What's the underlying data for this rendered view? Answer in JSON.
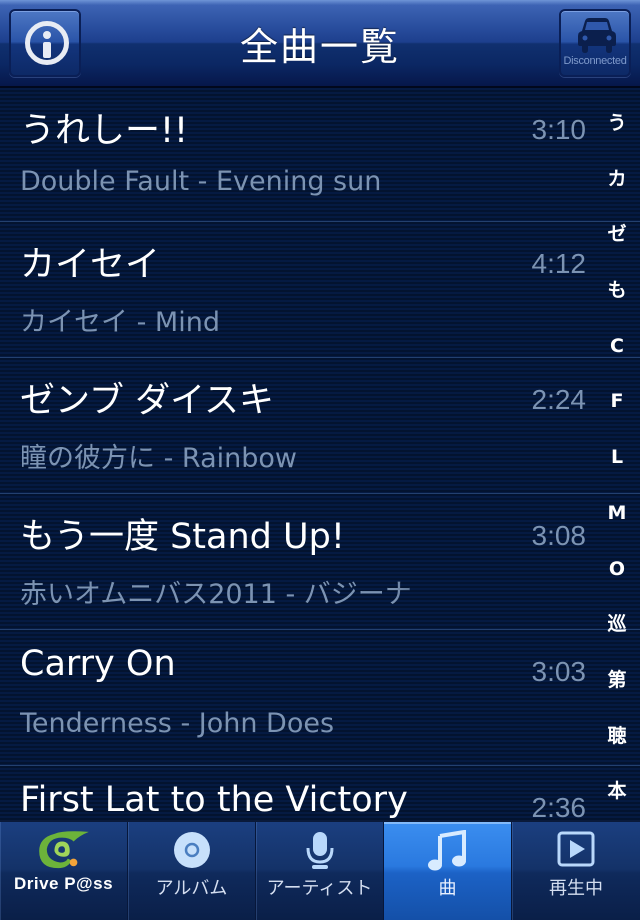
{
  "navbar": {
    "title": "全曲一覧",
    "info_button": {
      "icon": "info-icon"
    },
    "connection_button": {
      "icon": "car-icon",
      "status": "Disconnected"
    }
  },
  "songs": [
    {
      "title": "うれしー!!",
      "subtitle": "Double Fault - Evening sun",
      "duration": "3:10"
    },
    {
      "title": "カイセイ",
      "subtitle": "カイセイ - Mind",
      "duration": "4:12"
    },
    {
      "title": "ゼンブ ダイスキ",
      "subtitle": "瞳の彼方に - Rainbow",
      "duration": "2:24"
    },
    {
      "title": "もう一度 Stand Up!",
      "subtitle": "赤いオムニバス2011 - バジーナ",
      "duration": "3:08"
    },
    {
      "title": "Carry On",
      "subtitle": "Tenderness - John Does",
      "duration": "3:03"
    },
    {
      "title": "First Lat to the Victory",
      "subtitle": "",
      "duration": "2:36"
    }
  ],
  "index_bar": [
    "う",
    "カ",
    "ゼ",
    "も",
    "C",
    "F",
    "L",
    "M",
    "O",
    "巡",
    "第",
    "聴",
    "本"
  ],
  "tabbar": {
    "tabs": [
      {
        "label": "Drive P@ss",
        "icon": "drivepass-logo-icon",
        "active": false
      },
      {
        "label": "アルバム",
        "icon": "disc-icon",
        "active": false
      },
      {
        "label": "アーティスト",
        "icon": "microphone-icon",
        "active": false
      },
      {
        "label": "曲",
        "icon": "music-note-icon",
        "active": true
      },
      {
        "label": "再生中",
        "icon": "play-icon",
        "active": false
      }
    ]
  },
  "colors": {
    "accent_active_tab": "#2a79df",
    "secondary_text": "#7c93b2",
    "list_background": "#04163a"
  }
}
